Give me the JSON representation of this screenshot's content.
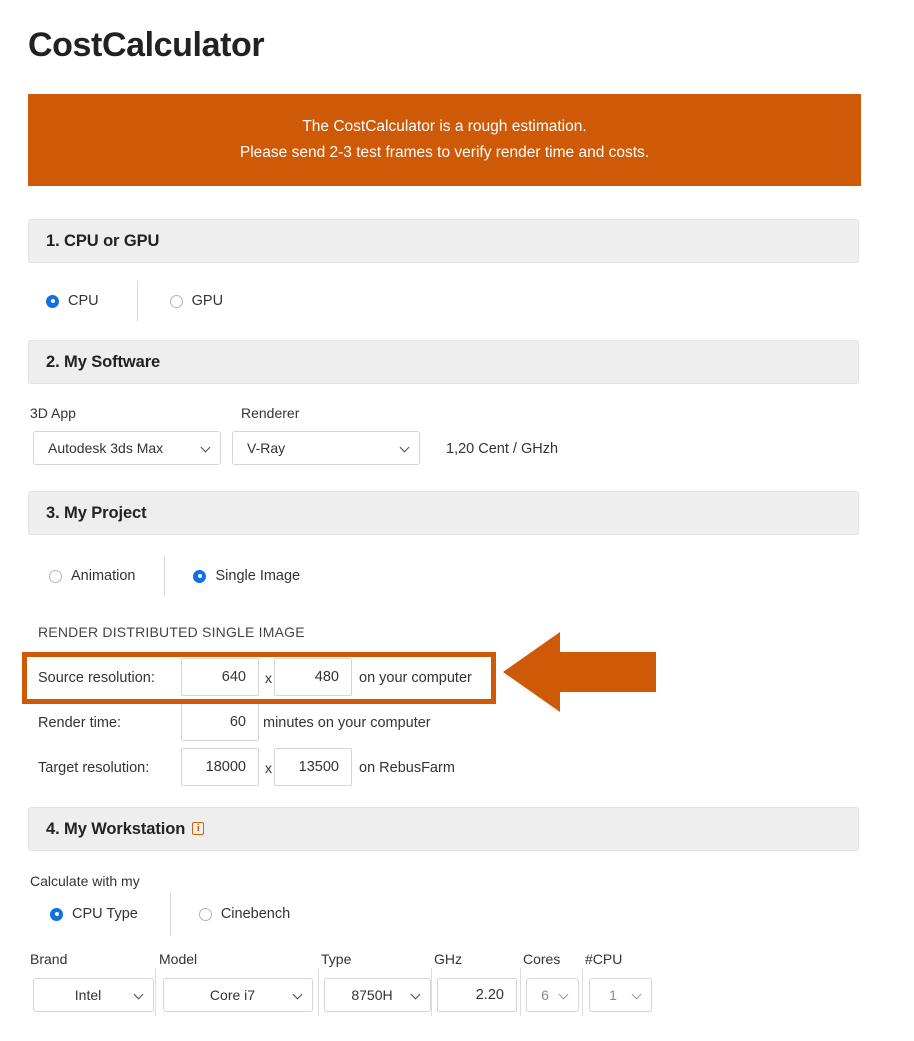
{
  "page": {
    "title": "CostCalculator"
  },
  "notice": {
    "line1": "The CostCalculator is a rough estimation.",
    "line2": "Please send 2-3 test frames to verify render time and costs.",
    "background": "#ce5a08",
    "text_color": "#ffffff"
  },
  "section1": {
    "header": "1. CPU or GPU",
    "options": [
      {
        "label": "CPU",
        "checked": true
      },
      {
        "label": "GPU",
        "checked": false
      }
    ]
  },
  "section2": {
    "header": "2. My Software",
    "app_label": "3D App",
    "app_value": "Autodesk 3ds Max",
    "renderer_label": "Renderer",
    "renderer_value": "V-Ray",
    "price_text": "1,20 Cent / GHzh"
  },
  "section3": {
    "header": "3. My Project",
    "options": [
      {
        "label": "Animation",
        "checked": false
      },
      {
        "label": "Single Image",
        "checked": true
      }
    ],
    "mode_caption": "RENDER DISTRIBUTED SINGLE IMAGE",
    "rows": [
      {
        "label": "Source resolution:",
        "value1": "640",
        "separator": "x",
        "value2": "480",
        "suffix": "on your computer"
      },
      {
        "label": "Render time:",
        "value1": "60",
        "suffix": "minutes on your computer"
      },
      {
        "label": "Target resolution:",
        "value1": "18000",
        "separator": "x",
        "value2": "13500",
        "suffix": "on RebusFarm"
      }
    ]
  },
  "section4": {
    "header": "4. My Workstation",
    "info_icon_glyph": "i",
    "calculate_label": "Calculate with my",
    "options": [
      {
        "label": "CPU Type",
        "checked": true
      },
      {
        "label": "Cinebench",
        "checked": false
      }
    ],
    "fields": [
      {
        "label": "Brand",
        "value": "Intel",
        "type": "select",
        "muted": false
      },
      {
        "label": "Model",
        "value": "Core i7",
        "type": "select",
        "muted": false
      },
      {
        "label": "Type",
        "value": "8750H",
        "type": "select",
        "muted": false
      },
      {
        "label": "GHz",
        "value": "2.20",
        "type": "input",
        "muted": false
      },
      {
        "label": "Cores",
        "value": "6",
        "type": "select",
        "muted": true
      },
      {
        "label": "#CPU",
        "value": "1",
        "type": "select",
        "muted": true
      }
    ]
  },
  "annotation": {
    "arrow_color": "#ce5a08",
    "highlight_color": "#ce5a08",
    "highlight_target": "Source resolution:"
  }
}
